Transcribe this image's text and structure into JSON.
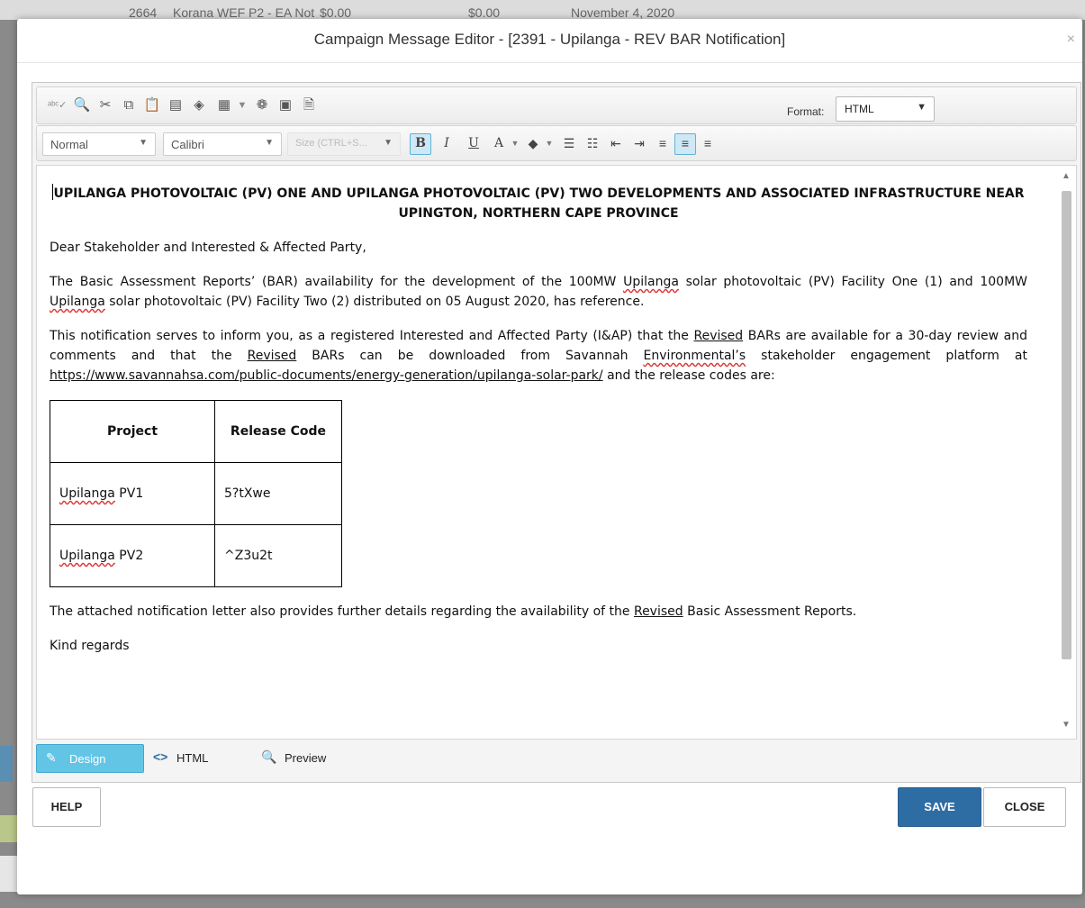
{
  "background": {
    "row_id": "2664",
    "row_name": "Korana WEF P2 - EA Not",
    "amount1": "$0.00",
    "amount2": "$0.00",
    "date": "November 4, 2020"
  },
  "dialog": {
    "title": "Campaign Message Editor - [2391 - Upilanga - REV BAR Notification]",
    "close_glyph": "×"
  },
  "toolbar": {
    "format_label": "Format:",
    "format_value": "HTML",
    "paragraph_style": "Normal",
    "font_name": "Calibri",
    "font_size_placeholder": "Size (CTRL+S..."
  },
  "document": {
    "heading": "UPILANGA PHOTOVOLTAIC (PV) ONE AND UPILANGA PHOTOVOLTAIC (PV) TWO DEVELOPMENTS AND ASSOCIATED INFRASTRUCTURE NEAR UPINGTON, NORTHERN CAPE PROVINCE",
    "salutation": "Dear Stakeholder and Interested & Affected Party,",
    "p1_a": "The Basic Assessment Reports’ (BAR) availability for the development of the 100MW ",
    "p1_b": "Upilanga",
    "p1_c": " solar photovoltaic (PV) Facility One (1) and 100MW ",
    "p1_d": "Upilanga",
    "p1_e": " solar photovoltaic (PV) Facility Two (2) distributed on 05 August 2020, has reference.",
    "p2_a": "This notification serves to inform you, as a registered Interested and Affected Party (I&AP) that the ",
    "p2_b": "Revised",
    "p2_c": " BARs are available for a 30-day review and comments and that the ",
    "p2_d": "Revised",
    "p2_e": " BARs can be downloaded from Savannah ",
    "p2_f": "Environmental’s",
    "p2_g": " stakeholder engagement platform at ",
    "p2_link": "https://www.savannahsa.com/public-documents/energy-generation/upilanga-solar-park/",
    "p2_h": " and the release codes are:",
    "table": {
      "headers": [
        "Project",
        "Release Code"
      ],
      "rows": [
        {
          "project_a": "Upilanga",
          "project_b": " PV1",
          "code": "5?tXwe"
        },
        {
          "project_a": "Upilanga",
          "project_b": " PV2",
          "code": "^Z3u2t"
        }
      ]
    },
    "p3_a": "The attached notification letter also provides further details regarding the availability of the ",
    "p3_b": "Revised",
    "p3_c": " Basic Assessment Reports.",
    "closing": "Kind regards"
  },
  "modes": {
    "design": "Design",
    "html": "HTML",
    "preview": "Preview"
  },
  "buttons": {
    "help": "HELP",
    "save": "SAVE",
    "close": "CLOSE"
  }
}
